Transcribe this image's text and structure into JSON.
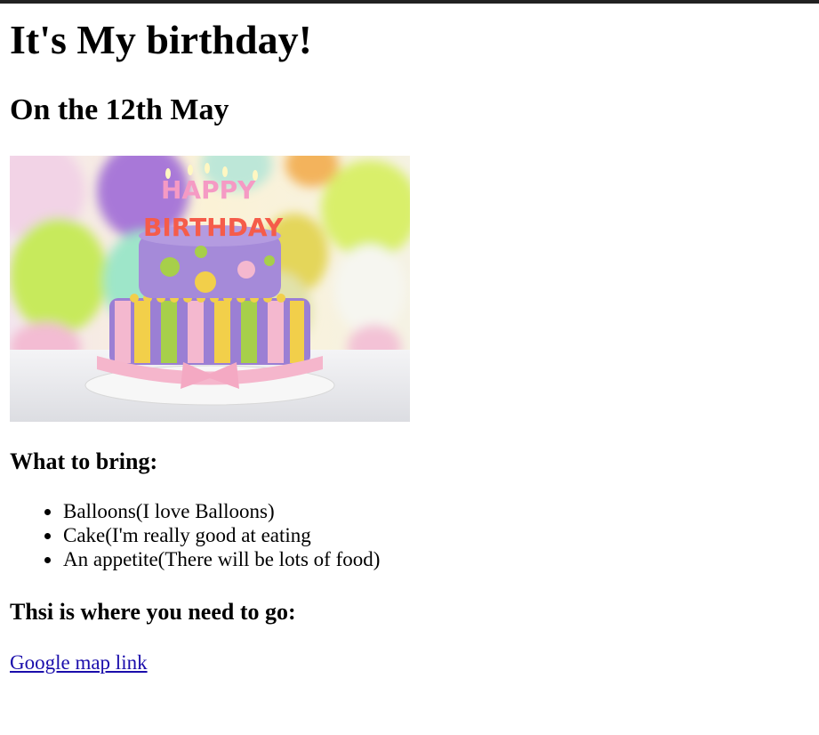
{
  "page": {
    "heading": "It's My birthday!",
    "subheading": "On the 12th May"
  },
  "image": {
    "cake_topper_line1": "HAPPY",
    "cake_topper_line2": "BIRTHDAY"
  },
  "bring": {
    "title": "What to bring:",
    "items": [
      "Balloons(I love Balloons)",
      "Cake(I'm really good at eating",
      "An appetite(There will be lots of food)"
    ]
  },
  "location": {
    "title": "Thsi is where you need to go:",
    "link_text": "Google map link"
  },
  "colors": {
    "link": "#1a0dab",
    "top_border": "#222222",
    "cake_purple": "#9b7fd4",
    "cake_pink": "#f4b8cf",
    "cake_yellow": "#f2cf4a",
    "cake_green": "#a7cf4a"
  }
}
